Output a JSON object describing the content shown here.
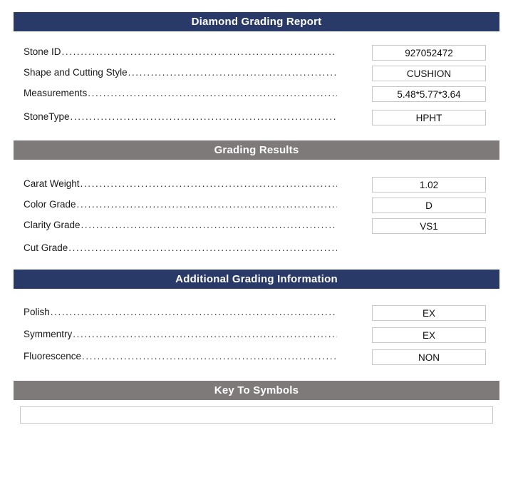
{
  "colors": {
    "navy_header": "#2a3a68",
    "gray_header": "#7e7a79",
    "box_border": "#c8c8c8",
    "page_background": "#ffffff",
    "text": "#1a1a1a"
  },
  "leader_dots": "..........................................................................................................",
  "sections": [
    {
      "title": "Diamond Grading Report",
      "style": "navy",
      "rows": [
        {
          "label": "Stone ID",
          "value": "927052472",
          "has_box": true
        },
        {
          "label": "Shape and Cutting Style",
          "value": "CUSHION",
          "has_box": true
        },
        {
          "label": "Measurements",
          "value": "5.48*5.77*3.64",
          "has_box": true
        },
        {
          "label": "StoneType",
          "value": "HPHT",
          "has_box": true
        }
      ]
    },
    {
      "title": "Grading Results",
      "style": "gray",
      "rows": [
        {
          "label": "Carat Weight",
          "value": "1.02",
          "has_box": true
        },
        {
          "label": "Color Grade",
          "value": "D",
          "has_box": true
        },
        {
          "label": "Clarity Grade",
          "value": "VS1",
          "has_box": true
        },
        {
          "label": "Cut Grade",
          "value": "",
          "has_box": false
        }
      ]
    },
    {
      "title": "Additional Grading Information",
      "style": "navy",
      "rows": [
        {
          "label": "Polish",
          "value": "EX",
          "has_box": true
        },
        {
          "label": "Symmentry",
          "value": "EX",
          "has_box": true
        },
        {
          "label": "Fluorescence",
          "value": "NON",
          "has_box": true
        }
      ]
    },
    {
      "title": "Key To Symbols",
      "style": "gray",
      "rows": [],
      "key_field_value": ""
    }
  ]
}
